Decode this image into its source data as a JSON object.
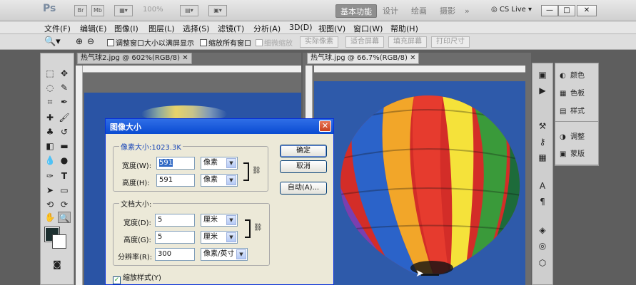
{
  "appbar": {
    "logo": "Ps",
    "icons": [
      "Br",
      "Mb"
    ],
    "zoom": "100%",
    "workspaces": [
      "基本功能",
      "设计",
      "绘画",
      "摄影"
    ],
    "more": "»",
    "cslive": "CS Live",
    "window_buttons": [
      "—",
      "□",
      "✕"
    ]
  },
  "menu": [
    "文件(F)",
    "编辑(E)",
    "图像(I)",
    "图层(L)",
    "选择(S)",
    "滤镜(T)",
    "分析(A)",
    "3D(D)",
    "视图(V)",
    "窗口(W)",
    "帮助(H)"
  ],
  "options": {
    "resize_windows": "调整窗口大小以满屏显示",
    "zoom_all": "缩放所有窗口",
    "scrubby": "细微缩放",
    "btn_actual": "实际像素",
    "btn_fit": "适合屏幕",
    "btn_fill": "填充屏幕",
    "btn_print": "打印尺寸"
  },
  "tabs": {
    "doc1": "热气球2.jpg @ 602%(RGB/8)",
    "doc2": "热气球.jpg @ 66.7%(RGB/8)",
    "close": "✕"
  },
  "panels": {
    "color": "颜色",
    "swatches": "色板",
    "styles": "样式",
    "adjustments": "调整",
    "masks": "蒙版"
  },
  "dialog": {
    "title": "图像大小",
    "close": "✕",
    "pixel_dims": "像素大小:1023.3K",
    "width_label": "宽度(W):",
    "width_value": "591",
    "width_unit": "像素",
    "height_label": "高度(H):",
    "height_value": "591",
    "height_unit": "像素",
    "doc_size": "文档大小:",
    "doc_width_label": "宽度(D):",
    "doc_width_value": "5",
    "doc_width_unit": "厘米",
    "doc_height_label": "高度(G):",
    "doc_height_value": "5",
    "doc_height_unit": "厘米",
    "resolution_label": "分辨率(R):",
    "resolution_value": "300",
    "resolution_unit": "像素/英寸",
    "scale_styles": "缩放样式(Y)",
    "ok": "确定",
    "cancel": "取消",
    "auto": "自动(A)..."
  },
  "colors": {
    "canvas_blue": "#2e5aaa",
    "dialog_title": "#0a4bd1",
    "foreground": "#1d3030",
    "background": "#ffffff"
  }
}
